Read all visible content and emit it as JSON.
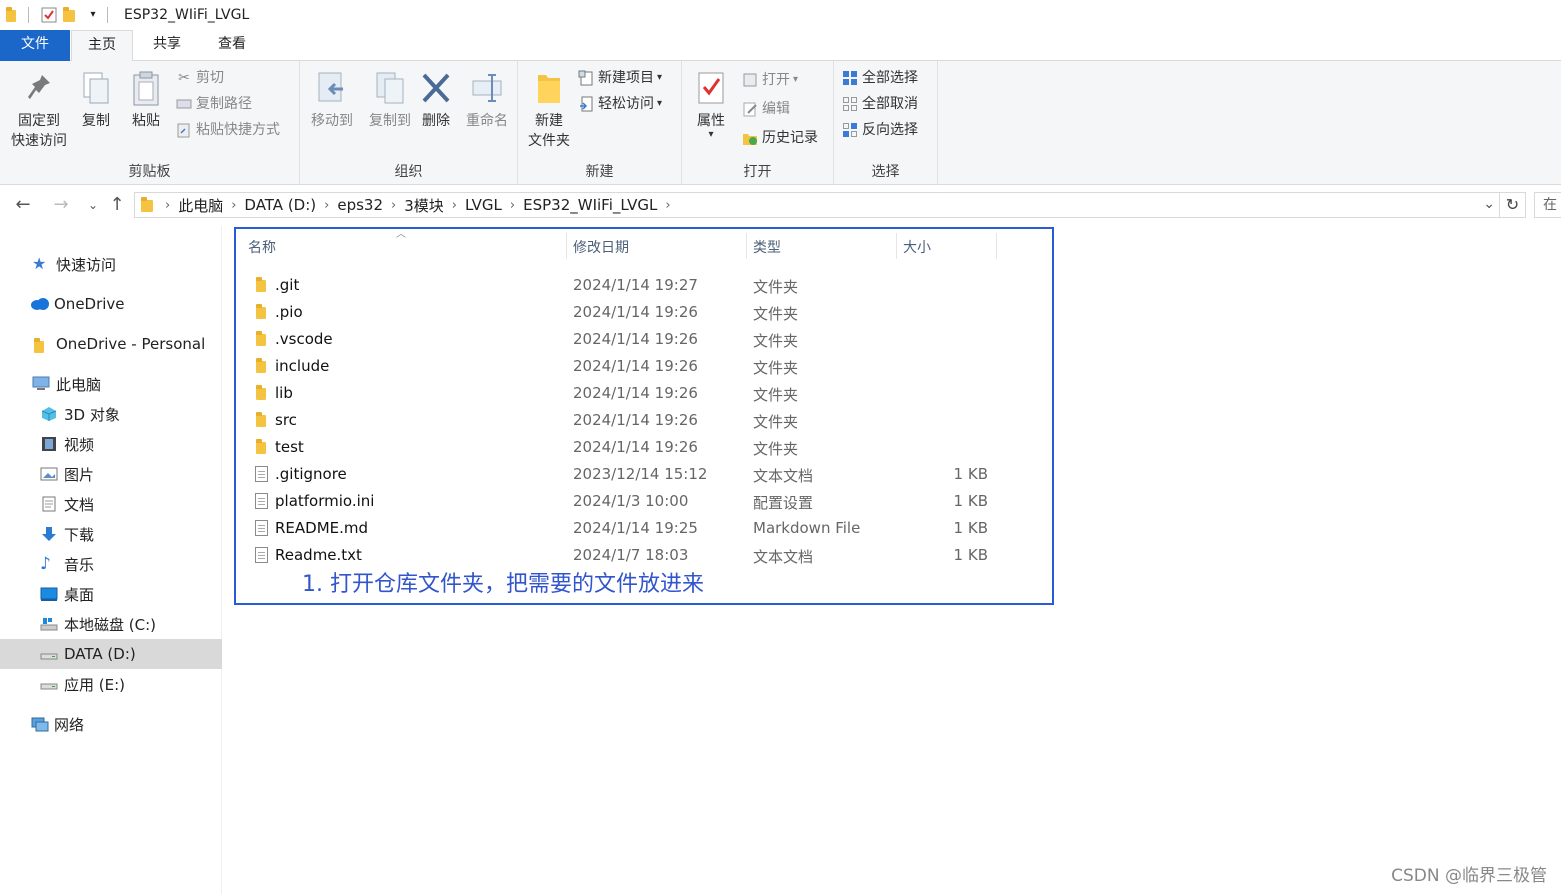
{
  "window": {
    "title": "ESP32_WIiFi_LVGL"
  },
  "tabs": [
    {
      "label": "文件"
    },
    {
      "label": "主页"
    },
    {
      "label": "共享"
    },
    {
      "label": "查看"
    }
  ],
  "ribbon": {
    "clipboard": {
      "label": "剪贴板",
      "pin": "固定到",
      "pin2": "快速访问",
      "copy": "复制",
      "paste": "粘贴",
      "cut": "剪切",
      "copy_path": "复制路径",
      "paste_shortcut": "粘贴快捷方式"
    },
    "organize": {
      "label": "组织",
      "move_to": "移动到",
      "copy_to": "复制到",
      "delete": "删除",
      "rename": "重命名"
    },
    "new": {
      "label": "新建",
      "new_folder": "新建",
      "new_folder2": "文件夹",
      "new_item": "新建项目",
      "easy_access": "轻松访问"
    },
    "open": {
      "label": "打开",
      "properties": "属性",
      "open": "打开",
      "edit": "编辑",
      "history": "历史记录"
    },
    "select": {
      "label": "选择",
      "select_all": "全部选择",
      "select_none": "全部取消",
      "invert": "反向选择"
    }
  },
  "address": {
    "crumbs": [
      "此电脑",
      "DATA (D:)",
      "eps32",
      "3模块",
      "LVGL",
      "ESP32_WIiFi_LVGL"
    ],
    "search_placeholder": "在"
  },
  "nav": {
    "items": [
      {
        "label": "快速访问",
        "icon": "star-icon"
      },
      {
        "label": "OneDrive",
        "icon": "cloud-icon"
      },
      {
        "label": "OneDrive - Personal",
        "icon": "folder-icon"
      },
      {
        "label": "此电脑",
        "icon": "computer-icon"
      },
      {
        "label": "3D 对象",
        "icon": "cube-icon"
      },
      {
        "label": "视频",
        "icon": "video-icon"
      },
      {
        "label": "图片",
        "icon": "picture-icon"
      },
      {
        "label": "文档",
        "icon": "document-icon"
      },
      {
        "label": "下载",
        "icon": "download-icon"
      },
      {
        "label": "音乐",
        "icon": "music-icon"
      },
      {
        "label": "桌面",
        "icon": "desktop-icon"
      },
      {
        "label": "本地磁盘 (C:)",
        "icon": "drive-c-icon"
      },
      {
        "label": "DATA (D:)",
        "icon": "drive-icon"
      },
      {
        "label": "应用 (E:)",
        "icon": "drive-icon"
      },
      {
        "label": "网络",
        "icon": "network-icon"
      }
    ]
  },
  "columns": {
    "name": "名称",
    "date": "修改日期",
    "type": "类型",
    "size": "大小"
  },
  "files": [
    {
      "name": ".git",
      "date": "2024/1/14 19:27",
      "type": "文件夹",
      "size": "",
      "kind": "folder"
    },
    {
      "name": ".pio",
      "date": "2024/1/14 19:26",
      "type": "文件夹",
      "size": "",
      "kind": "folder"
    },
    {
      "name": ".vscode",
      "date": "2024/1/14 19:26",
      "type": "文件夹",
      "size": "",
      "kind": "folder"
    },
    {
      "name": "include",
      "date": "2024/1/14 19:26",
      "type": "文件夹",
      "size": "",
      "kind": "folder"
    },
    {
      "name": "lib",
      "date": "2024/1/14 19:26",
      "type": "文件夹",
      "size": "",
      "kind": "folder"
    },
    {
      "name": "src",
      "date": "2024/1/14 19:26",
      "type": "文件夹",
      "size": "",
      "kind": "folder"
    },
    {
      "name": "test",
      "date": "2024/1/14 19:26",
      "type": "文件夹",
      "size": "",
      "kind": "folder"
    },
    {
      "name": ".gitignore",
      "date": "2023/12/14 15:12",
      "type": "文本文档",
      "size": "1 KB",
      "kind": "file"
    },
    {
      "name": "platformio.ini",
      "date": "2024/1/3 10:00",
      "type": "配置设置",
      "size": "1 KB",
      "kind": "file"
    },
    {
      "name": "README.md",
      "date": "2024/1/14 19:25",
      "type": "Markdown File",
      "size": "1 KB",
      "kind": "file"
    },
    {
      "name": "Readme.txt",
      "date": "2024/1/7 18:03",
      "type": "文本文档",
      "size": "1 KB",
      "kind": "file"
    }
  ],
  "annotation": "1. 打开仓库文件夹，把需要的文件放进来",
  "watermark": "CSDN @临界三极管",
  "colors": {
    "accent": "#1a66c9",
    "highlight_box": "#2b5ad6",
    "annotation": "#3355cc",
    "folder": "#f5c342"
  }
}
